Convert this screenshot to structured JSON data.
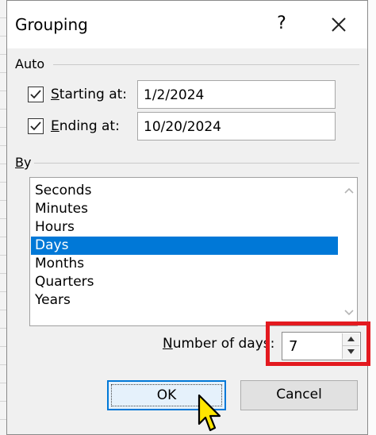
{
  "dialog": {
    "title": "Grouping",
    "help_label": "?"
  },
  "auto": {
    "label": "Auto",
    "starting": {
      "prefix": "",
      "accel": "S",
      "rest": "tarting at:",
      "value": "1/2/2024",
      "checked": true
    },
    "ending": {
      "prefix": "",
      "accel": "E",
      "rest": "nding at:",
      "value": "10/20/2024",
      "checked": true
    }
  },
  "by": {
    "accel": "B",
    "rest": "y",
    "items": [
      "Seconds",
      "Minutes",
      "Hours",
      "Days",
      "Months",
      "Quarters",
      "Years"
    ],
    "selected": "Days"
  },
  "number_of_days": {
    "accel": "N",
    "rest": "umber of days:",
    "value": "7"
  },
  "buttons": {
    "ok": "OK",
    "cancel": "Cancel"
  },
  "colors": {
    "selection": "#0078d7",
    "highlight_box": "#e3191f",
    "cursor": "#ffe600"
  }
}
